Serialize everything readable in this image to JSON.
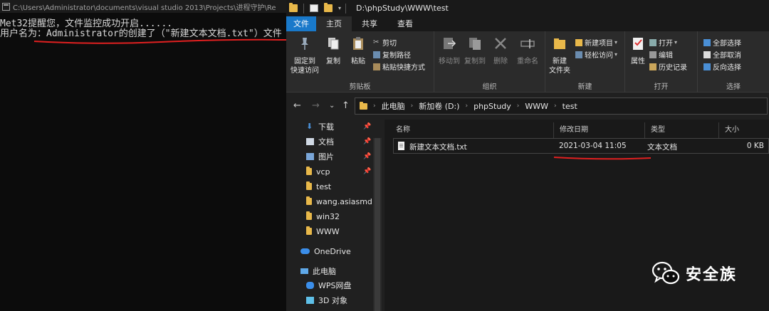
{
  "console": {
    "title": "C:\\Users\\Administrator\\documents\\visual studio 2013\\Projects\\进程守护\\Re",
    "lines": [
      "Met32提醒您，文件监控成功开启......",
      "用户名为：Administrator的创建了（\"新建文本文档.txt\"）文件"
    ],
    "annotation_color": "#e02020"
  },
  "explorer": {
    "window_title": "D:\\phpStudy\\WWW\\test",
    "tabs": [
      "文件",
      "主页",
      "共享",
      "查看"
    ],
    "ribbon": {
      "clipboard": {
        "label": "剪贴板",
        "pin": "固定到\n快速访问",
        "copy": "复制",
        "paste": "粘贴",
        "cut": "剪切",
        "copy_path": "复制路径",
        "paste_shortcut": "粘贴快捷方式"
      },
      "organize": {
        "label": "组织",
        "move_to": "移动到",
        "copy_to": "复制到",
        "delete": "删除",
        "rename": "重命名"
      },
      "new": {
        "label": "新建",
        "new_folder": "新建\n文件夹",
        "new_item": "新建项目",
        "easy_access": "轻松访问"
      },
      "open": {
        "label": "打开",
        "properties": "属性",
        "open": "打开",
        "edit": "编辑",
        "history": "历史记录"
      },
      "select": {
        "label": "选择",
        "select_all": "全部选择",
        "select_none": "全部取消",
        "invert": "反向选择"
      }
    },
    "breadcrumb": [
      "此电脑",
      "新加卷 (D:)",
      "phpStudy",
      "WWW",
      "test"
    ],
    "nav_pane": [
      {
        "label": "下载",
        "pinned": true,
        "icon": "download-icon"
      },
      {
        "label": "文档",
        "pinned": true,
        "icon": "document-icon"
      },
      {
        "label": "图片",
        "pinned": true,
        "icon": "picture-icon"
      },
      {
        "label": "vcp",
        "pinned": true,
        "icon": "folder-icon"
      },
      {
        "label": "test",
        "pinned": false,
        "icon": "folder-icon"
      },
      {
        "label": "wang.asiasmd-l",
        "pinned": false,
        "icon": "folder-icon"
      },
      {
        "label": "win32",
        "pinned": false,
        "icon": "folder-icon"
      },
      {
        "label": "WWW",
        "pinned": false,
        "icon": "folder-icon"
      },
      {
        "label": "OneDrive",
        "pinned": false,
        "icon": "cloud-icon"
      },
      {
        "label": "此电脑",
        "pinned": false,
        "icon": "computer-icon"
      },
      {
        "label": "WPS网盘",
        "pinned": false,
        "icon": "wps-cloud-icon"
      },
      {
        "label": "3D 对象",
        "pinned": false,
        "icon": "3d-objects-icon"
      }
    ],
    "columns": [
      "名称",
      "修改日期",
      "类型",
      "大小"
    ],
    "files": [
      {
        "name": "新建文本文档.txt",
        "modified": "2021-03-04 11:05",
        "type": "文本文档",
        "size": "0 KB"
      }
    ]
  },
  "watermark": {
    "text": "安全族",
    "icon": "wechat-icon"
  }
}
